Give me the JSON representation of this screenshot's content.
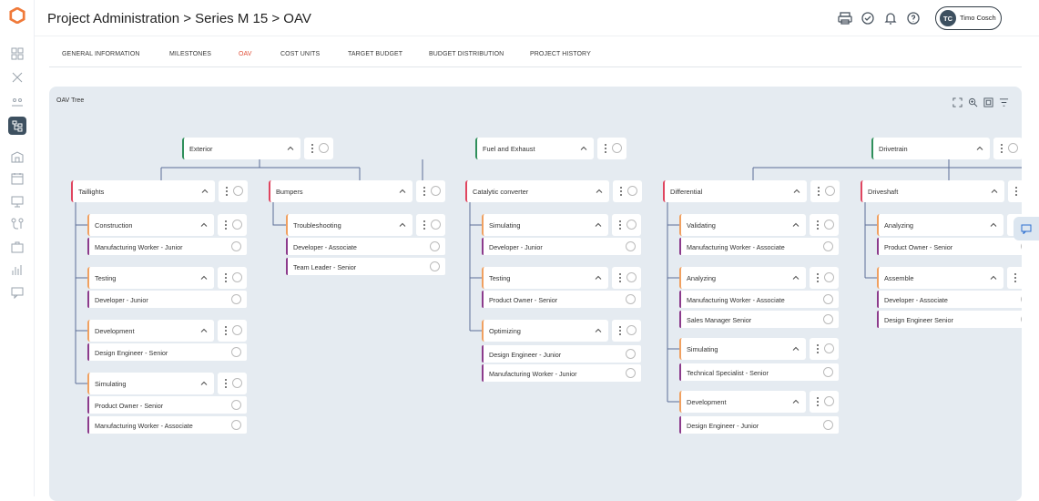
{
  "colors": {
    "accent": "#e1533c",
    "sidebar_active": "#3d5060",
    "panel_bg": "#e5ebf1",
    "line": "#5b6e98",
    "green": "#2f8f5b",
    "red": "#e0455f",
    "orange": "#f0a060",
    "purple": "#8c3b8c"
  },
  "header": {
    "breadcrumb": "Project Administration > Series M 15 > OAV",
    "user_initials": "TC",
    "user_name": "Timo Cosch",
    "icons": [
      "print-icon",
      "check-circle-icon",
      "bell-icon",
      "help-icon"
    ]
  },
  "sidebar": {
    "logo": "app-logo",
    "items": [
      "dashboard-icon",
      "tools-icon",
      "team-icon",
      "oav-tree-icon",
      "building-icon",
      "calendar-icon",
      "monitor-icon",
      "branches-icon",
      "briefcase-icon",
      "chart-icon",
      "chat-icon"
    ]
  },
  "tabs": [
    {
      "label": "GENERAL INFORMATION"
    },
    {
      "label": "MILESTONES"
    },
    {
      "label": "OAV"
    },
    {
      "label": "COST UNITS"
    },
    {
      "label": "TARGET BUDGET"
    },
    {
      "label": "BUDGET DISTRIBUTION"
    },
    {
      "label": "PROJECT HISTORY"
    }
  ],
  "panel": {
    "title": "OAV Tree",
    "toolbar_icons": [
      "fullscreen-icon",
      "zoom-icon",
      "fit-icon",
      "filter-icon"
    ]
  },
  "tree": {
    "roots": [
      {
        "label": "Exterior"
      },
      {
        "label": "Fuel and Exhaust"
      },
      {
        "label": "Drivetrain"
      }
    ],
    "branches": [
      {
        "label": "Taillights",
        "groups": [
          {
            "label": "Construction",
            "roles": [
              "Manufacturing Worker - Junior"
            ]
          },
          {
            "label": "Testing",
            "roles": [
              "Developer - Junior"
            ]
          },
          {
            "label": "Development",
            "roles": [
              "Design Engineer - Senior"
            ]
          },
          {
            "label": "Simulating",
            "roles": [
              "Product Owner - Senior",
              "Manufacturing Worker - Associate"
            ]
          }
        ]
      },
      {
        "label": "Bumpers",
        "groups": [
          {
            "label": "Troubleshooting",
            "roles": [
              "Developer - Associate",
              "Team Leader - Senior"
            ]
          }
        ]
      },
      {
        "label": "Catalytic converter",
        "groups": [
          {
            "label": "Simulating",
            "roles": [
              "Developer - Junior"
            ]
          },
          {
            "label": "Testing",
            "roles": [
              "Product Owner - Senior"
            ]
          },
          {
            "label": "Optimizing",
            "roles": [
              "Design Engineer - Junior",
              "Manufacturing Worker - Junior"
            ]
          }
        ]
      },
      {
        "label": "Differential",
        "groups": [
          {
            "label": "Validating",
            "roles": [
              "Manufacturing Worker - Associate"
            ]
          },
          {
            "label": "Analyzing",
            "roles": [
              "Manufacturing Worker - Associate",
              "Sales Manager   Senior"
            ]
          },
          {
            "label": "Simulating",
            "roles": [
              "Technical Specialist - Senior"
            ]
          },
          {
            "label": "Development",
            "roles": [
              "Design Engineer - Junior"
            ]
          }
        ]
      },
      {
        "label": "Driveshaft",
        "groups": [
          {
            "label": "Analyzing",
            "roles": [
              "Product Owner - Senior"
            ]
          },
          {
            "label": "Assemble",
            "roles": [
              "Developer - Associate",
              "Design Engineer   Senior"
            ]
          }
        ]
      }
    ]
  }
}
